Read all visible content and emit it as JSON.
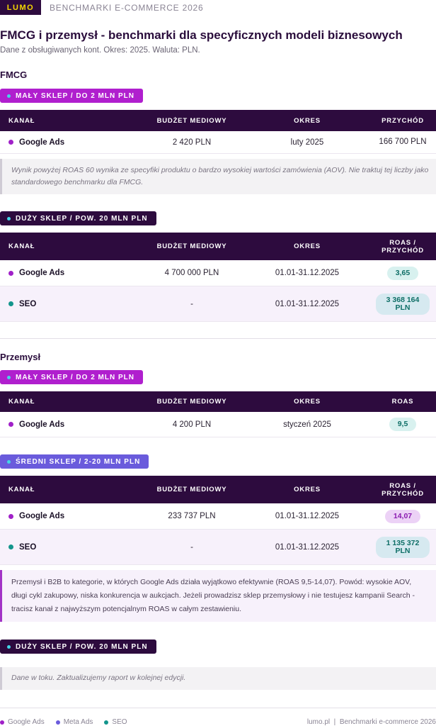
{
  "header": {
    "logo": "LUMO",
    "title": "BENCHMARKI E-COMMERCE 2026"
  },
  "page": {
    "title": "FMCG i przemysł - benchmarki dla specyficznych modeli biznesowych",
    "subtitle": "Dane z obsługiwanych kont. Okres: 2025. Waluta: PLN."
  },
  "colors": {
    "google_ads": "#a020c8",
    "meta_ads": "#6a5bdc",
    "seo": "#13958c",
    "header_bg": "#2d0b3e"
  },
  "fmcg": {
    "title": "FMCG",
    "small": {
      "pill": "MAŁY SKLEP  /  DO 2 MLN PLN",
      "headers": [
        "KANAŁ",
        "BUDŻET MEDIOWY",
        "OKRES",
        "PRZYCHÓD"
      ],
      "rows": [
        {
          "channel": "Google Ads",
          "budget": "2 420 PLN",
          "period": "luty 2025",
          "result": "166 700 PLN"
        }
      ],
      "note": "Wynik powyżej ROAS 60 wynika ze specyfiki produktu o bardzo wysokiej wartości zamówienia (AOV). Nie traktuj tej liczby jako standardowego benchmarku dla FMCG."
    },
    "large": {
      "pill": "DUŻY SKLEP  /  POW. 20 MLN PLN",
      "headers": [
        "KANAŁ",
        "BUDŻET MEDIOWY",
        "OKRES",
        "ROAS / PRZYCHÓD"
      ],
      "rows": [
        {
          "channel": "Google Ads",
          "budget": "4 700 000 PLN",
          "period": "01.01-31.12.2025",
          "result": "3,65"
        },
        {
          "channel": "SEO",
          "budget": "-",
          "period": "01.01-31.12.2025",
          "result_line1": "3 368 164",
          "result_line2": "PLN"
        }
      ]
    }
  },
  "industry": {
    "title": "Przemysł",
    "small": {
      "pill": "MAŁY SKLEP  /  DO 2 MLN PLN",
      "headers": [
        "KANAŁ",
        "BUDŻET MEDIOWY",
        "OKRES",
        "ROAS"
      ],
      "rows": [
        {
          "channel": "Google Ads",
          "budget": "4 200 PLN",
          "period": "styczeń 2025",
          "result": "9,5"
        }
      ]
    },
    "medium": {
      "pill": "ŚREDNI SKLEP  /  2-20 MLN PLN",
      "headers": [
        "KANAŁ",
        "BUDŻET MEDIOWY",
        "OKRES",
        "ROAS / PRZYCHÓD"
      ],
      "rows": [
        {
          "channel": "Google Ads",
          "budget": "233 737 PLN",
          "period": "01.01-31.12.2025",
          "result": "14,07"
        },
        {
          "channel": "SEO",
          "budget": "-",
          "period": "01.01-31.12.2025",
          "result_line1": "1 135 372",
          "result_line2": "PLN"
        }
      ],
      "note": "Przemysł i B2B to kategorie, w których Google Ads działa wyjątkowo efektywnie (ROAS 9,5-14,07). Powód: wysokie AOV, długi cykl zakupowy, niska konkurencja w aukcjach. Jeżeli prowadzisz sklep przemysłowy i nie testujesz kampanii Search - tracisz kanał z najwyższym potencjalnym ROAS w całym zestawieniu."
    },
    "large": {
      "pill": "DUŻY SKLEP  /  POW. 20 MLN PLN",
      "note": "Dane w toku. Zaktualizujemy raport w kolejnej edycji."
    }
  },
  "footer": {
    "legend": [
      "Google Ads",
      "Meta Ads",
      "SEO"
    ],
    "right": "lumo.pl  |  Benchmarki e-commerce 2026"
  }
}
